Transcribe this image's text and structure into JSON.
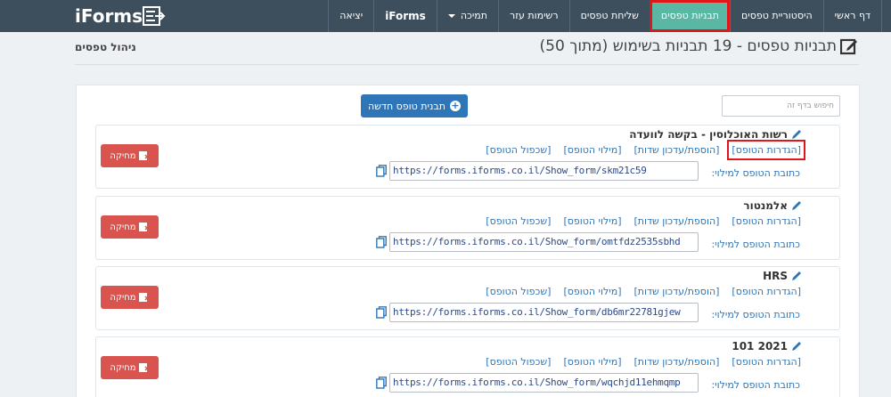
{
  "nav": {
    "items": [
      {
        "label": "דף ראשי"
      },
      {
        "label": "היסטוריית טפסים"
      },
      {
        "label": "תבניות טפסים",
        "active": true
      },
      {
        "label": "שליחת טפסים"
      },
      {
        "label": "רשימות עזר"
      },
      {
        "label": "תמיכה",
        "dropdown": true
      },
      {
        "label": "iForms",
        "bold": true
      },
      {
        "label": "יציאה"
      }
    ],
    "logo_text": "iForms"
  },
  "header": {
    "title": "תבניות טפסים - 19 תבניות בשימוש (מתוך 50)",
    "manage_link": "ניהול טפסים"
  },
  "toolbar": {
    "search_placeholder": "חיפוש בדף זה",
    "new_template_label": "תבנית טופס חדשה"
  },
  "cards": [
    {
      "title": "רשות האוכלוסין - בקשה לוועדה",
      "links": [
        "[הגדרות הטופס]",
        "[הוספת/עדכון שדות]",
        "[מילוי הטופס]",
        "[שכפול הטופס]"
      ],
      "url_label": "כתובת הטופס למילוי:",
      "url": "https://forms.iforms.co.il/Show_form/skm21c59",
      "delete_label": "מחיקה"
    },
    {
      "title": "אלמנטור",
      "links": [
        "[הגדרות הטופס]",
        "[הוספת/עדכון שדות]",
        "[מילוי הטופס]",
        "[שכפול הטופס]"
      ],
      "url_label": "כתובת הטופס למילוי:",
      "url": "https://forms.iforms.co.il/Show_form/omtfdz2535sbhd",
      "delete_label": "מחיקה"
    },
    {
      "title": "HRS",
      "links": [
        "[הגדרות הטופס]",
        "[הוספת/עדכון שדות]",
        "[מילוי הטופס]",
        "[שכפול הטופס]"
      ],
      "url_label": "כתובת הטופס למילוי:",
      "url": "https://forms.iforms.co.il/Show_form/db6mr22781gjew",
      "delete_label": "מחיקה"
    },
    {
      "title": "2021 101",
      "links": [
        "[הגדרות הטופס]",
        "[הוספת/עדכון שדות]",
        "[מילוי הטופס]",
        "[שכפול הטופס]"
      ],
      "url_label": "כתובת הטופס למילוי:",
      "url": "https://forms.iforms.co.il/Show_form/wqchjd11ehmqmp",
      "delete_label": "מחיקה"
    }
  ],
  "colors": {
    "nav_bg": "#3d4e5d",
    "active_tab": "#5ab7a4",
    "primary": "#2f76b8",
    "danger": "#d9534f",
    "highlight": "#e1161b"
  }
}
